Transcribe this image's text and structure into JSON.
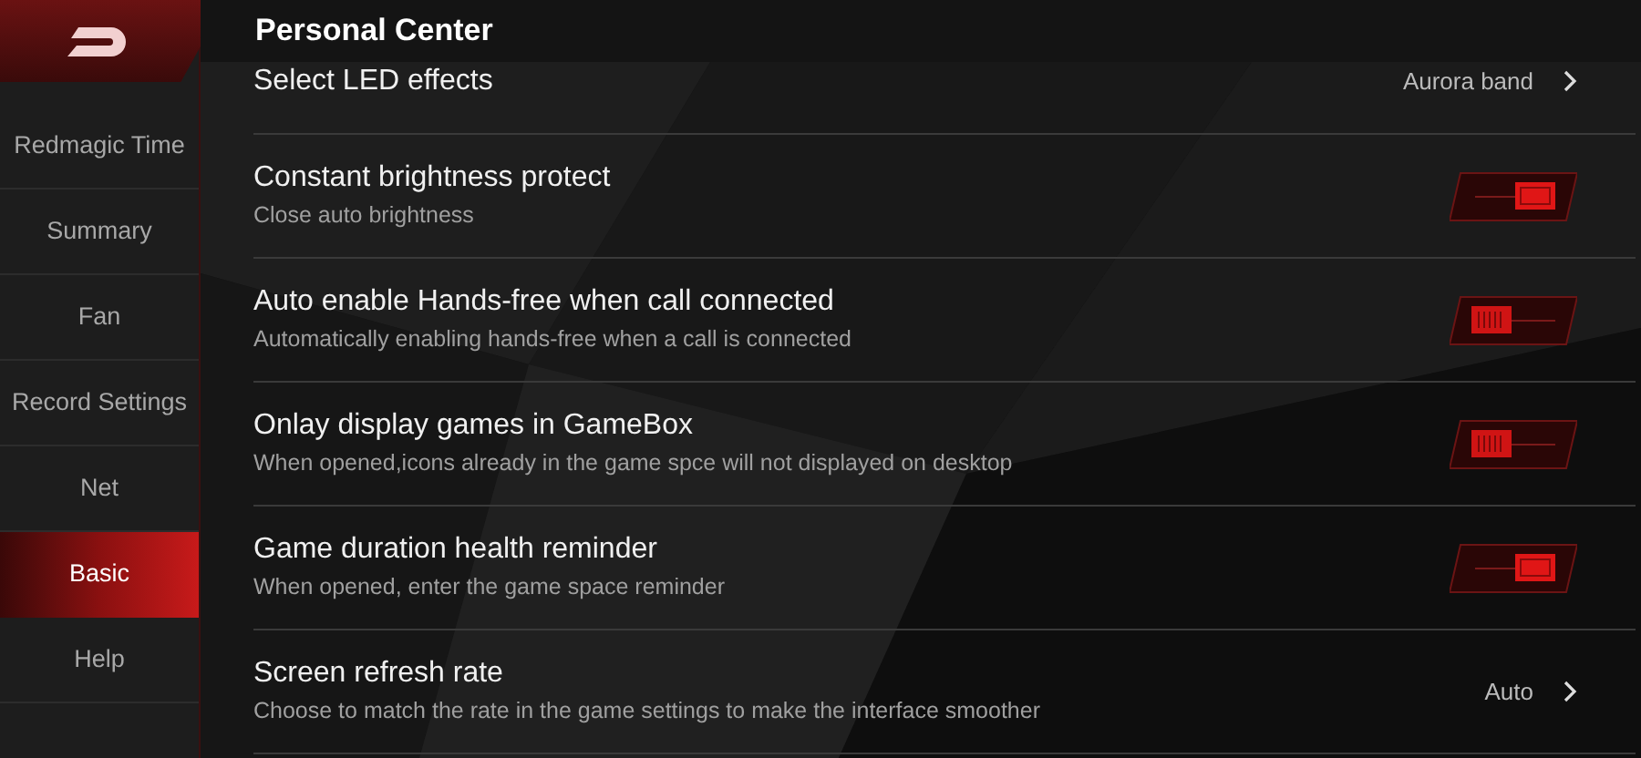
{
  "header": {
    "title": "Personal Center"
  },
  "sidebar": {
    "items": [
      {
        "label": "Redmagic Time",
        "selected": false
      },
      {
        "label": "Summary",
        "selected": false
      },
      {
        "label": "Fan",
        "selected": false
      },
      {
        "label": "Record Settings",
        "selected": false
      },
      {
        "label": "Net",
        "selected": false
      },
      {
        "label": "Basic",
        "selected": true
      },
      {
        "label": "Help",
        "selected": false
      }
    ]
  },
  "settings": [
    {
      "kind": "link",
      "title": "Select LED effects",
      "value": "Aurora band"
    },
    {
      "kind": "toggle",
      "title": "Constant brightness protect",
      "subtitle": "Close auto brightness",
      "on": true
    },
    {
      "kind": "toggle",
      "title": "Auto enable Hands-free when call connected",
      "subtitle": "Automatically enabling hands-free when a call is connected",
      "on": false
    },
    {
      "kind": "toggle",
      "title": "Onlay display games in GameBox",
      "subtitle": "When opened,icons already in the game spce will not displayed on desktop",
      "on": false
    },
    {
      "kind": "toggle",
      "title": "Game duration health reminder",
      "subtitle": "When opened, enter the game space reminder",
      "on": true
    },
    {
      "kind": "link",
      "title": "Screen refresh rate",
      "subtitle": "Choose to match the rate in the game settings to make the interface smoother",
      "value": "Auto"
    }
  ]
}
